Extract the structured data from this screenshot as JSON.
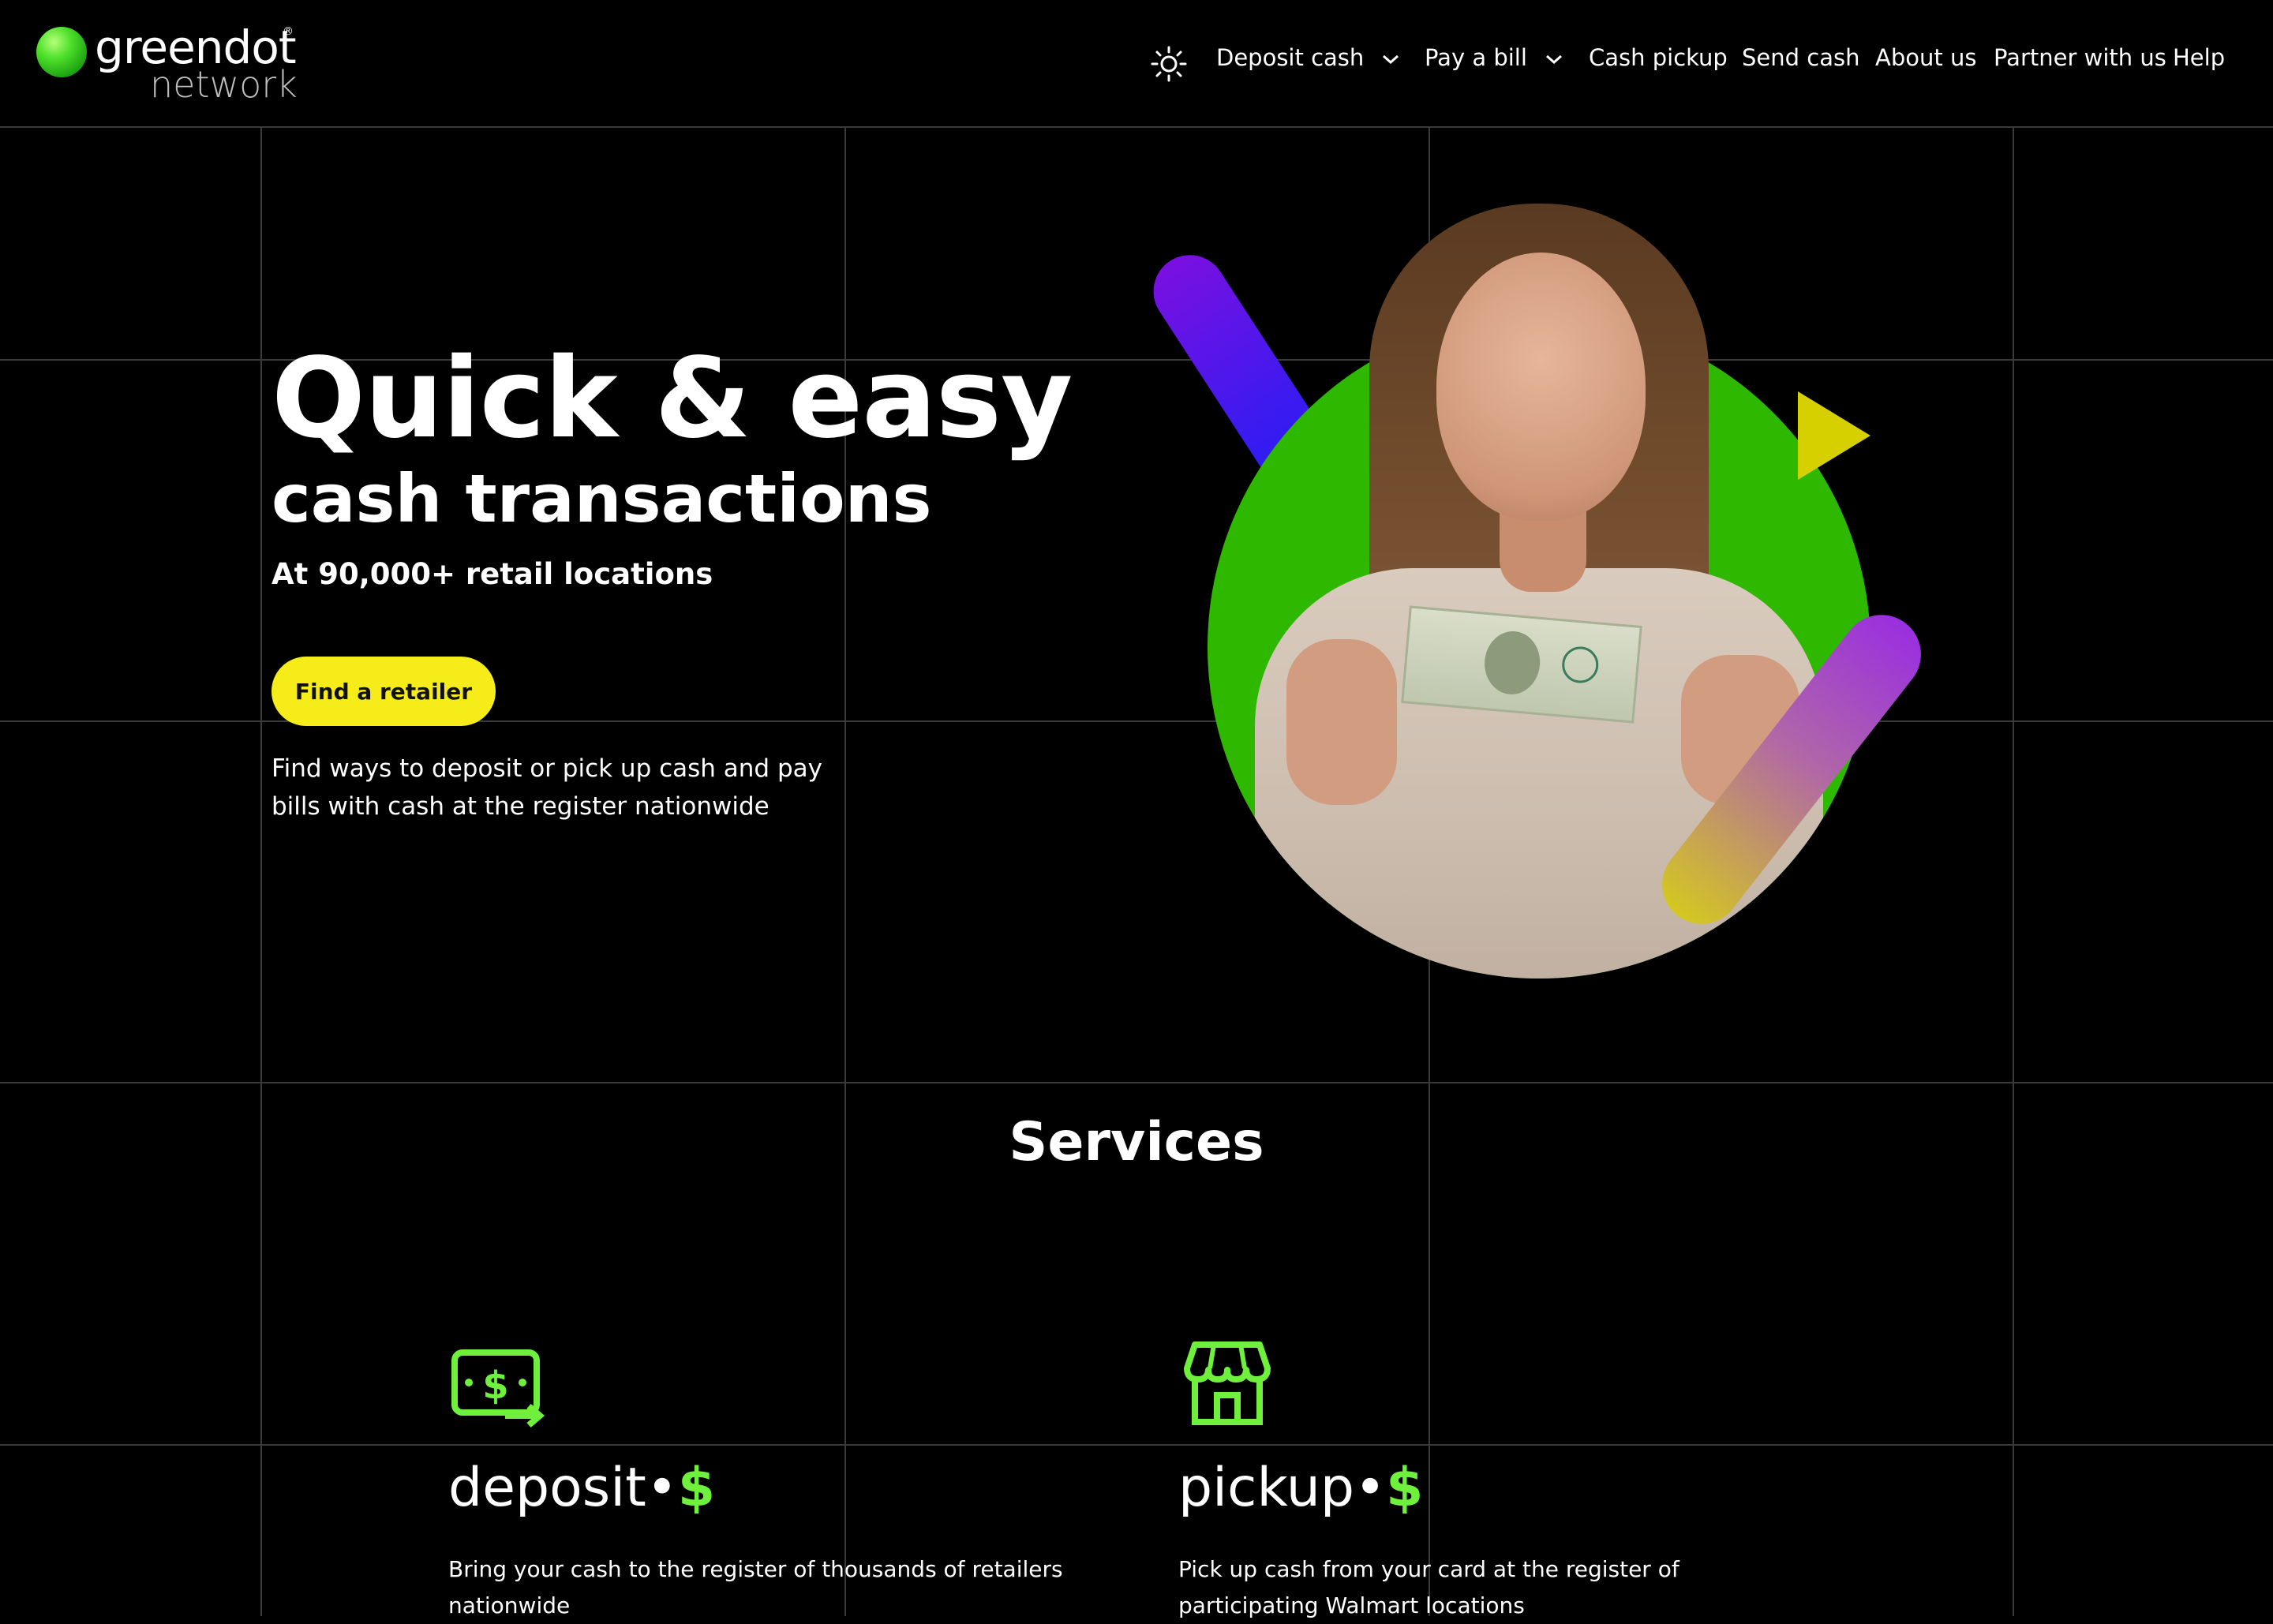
{
  "brand": {
    "name": "greendot",
    "sub": "network",
    "reg": "®"
  },
  "nav": {
    "theme_icon": "sun-icon",
    "items": [
      {
        "label": "Deposit cash",
        "has_dropdown": true
      },
      {
        "label": "Pay a bill",
        "has_dropdown": true
      },
      {
        "label": "Cash pickup",
        "has_dropdown": false
      },
      {
        "label": "Send cash",
        "has_dropdown": false
      },
      {
        "label": "About us",
        "has_dropdown": false
      },
      {
        "label": "Partner with us",
        "has_dropdown": false
      },
      {
        "label": "Help",
        "has_dropdown": false
      }
    ]
  },
  "hero": {
    "title": "Quick & easy",
    "subtitle": "cash transactions",
    "kicker": "At 90,000+ retail locations",
    "cta": "Find a retailer",
    "description": "Find ways to deposit or pick up cash and pay bills with cash at the register nationwide"
  },
  "services": {
    "title": "Services",
    "items": [
      {
        "name": "deposit",
        "dot": "•",
        "dollar": "$",
        "icon": "cash-deposit-icon",
        "description": "Bring your cash to the register of thousands of retailers nationwide"
      },
      {
        "name": "pickup",
        "dot": "•",
        "dollar": "$",
        "icon": "storefront-icon",
        "description": "Pick up cash from your card at the register of participating Walmart locations"
      }
    ]
  },
  "colors": {
    "background": "#000000",
    "accent_green": "#6ff03c",
    "cta_yellow": "#f5ec1a",
    "hero_circle": "#2eb800"
  }
}
